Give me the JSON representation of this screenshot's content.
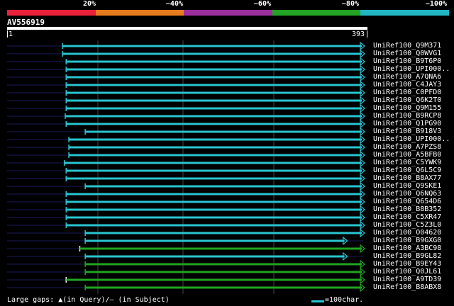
{
  "legend": {
    "labels": [
      "20%",
      "~40%",
      "~60%",
      "~80%",
      "~100%"
    ],
    "colors": [
      "#e8203a",
      "#e57c1e",
      "#9b2f9e",
      "#23a323",
      "#22b6c1"
    ]
  },
  "query": {
    "id": "AV556919",
    "start_label": "1",
    "end_label": "393",
    "length": 393
  },
  "colors": {
    "faint_line": "#1a1a5a",
    "grid": "#444444",
    "cyan": "#29c5cf",
    "green": "#1fa51f"
  },
  "hits": [
    {
      "name": "UniRef100_Q9M371",
      "start": 62,
      "end": 393,
      "color": "cyan",
      "gap_start": false
    },
    {
      "name": "UniRef100_Q0WVG1",
      "start": 62,
      "end": 393,
      "color": "cyan",
      "gap_start": false
    },
    {
      "name": "UniRef100_B9T6P0",
      "start": 66,
      "end": 393,
      "color": "cyan",
      "gap_start": false
    },
    {
      "name": "UniRef100_UPI000..",
      "start": 66,
      "end": 393,
      "color": "cyan",
      "gap_start": false
    },
    {
      "name": "UniRef100_A7QNA6",
      "start": 66,
      "end": 393,
      "color": "cyan",
      "gap_start": false
    },
    {
      "name": "UniRef100_C4JAY3",
      "start": 66,
      "end": 393,
      "color": "cyan",
      "gap_start": false
    },
    {
      "name": "UniRef100_C0PFD0",
      "start": 66,
      "end": 393,
      "color": "cyan",
      "gap_start": false
    },
    {
      "name": "UniRef100_Q6K2T0",
      "start": 66,
      "end": 393,
      "color": "cyan",
      "gap_start": false
    },
    {
      "name": "UniRef100_Q9M155",
      "start": 66,
      "end": 393,
      "color": "cyan",
      "gap_start": false
    },
    {
      "name": "UniRef100_B9RCP8",
      "start": 65,
      "end": 393,
      "color": "cyan",
      "gap_start": false
    },
    {
      "name": "UniRef100_Q1PG90",
      "start": 66,
      "end": 393,
      "color": "cyan",
      "gap_start": false
    },
    {
      "name": "UniRef100_B918V3",
      "start": 87,
      "end": 393,
      "color": "cyan",
      "gap_start": false
    },
    {
      "name": "UniRef100_UPI000..",
      "start": 69,
      "end": 393,
      "color": "cyan",
      "gap_start": false
    },
    {
      "name": "UniRef100_A7PZS8",
      "start": 69,
      "end": 393,
      "color": "cyan",
      "gap_start": false
    },
    {
      "name": "UniRef100_A5BFB0",
      "start": 69,
      "end": 393,
      "color": "cyan",
      "gap_start": false
    },
    {
      "name": "UniRef100_C5YWK9",
      "start": 64,
      "end": 393,
      "color": "cyan",
      "gap_start": false
    },
    {
      "name": "UniRef100_Q6L5C9",
      "start": 66,
      "end": 393,
      "color": "cyan",
      "gap_start": false
    },
    {
      "name": "UniRef100_B8AX77",
      "start": 66,
      "end": 393,
      "color": "cyan",
      "gap_start": false
    },
    {
      "name": "UniRef100_Q9SKE1",
      "start": 87,
      "end": 393,
      "color": "cyan",
      "gap_start": false
    },
    {
      "name": "UniRef100_Q6NQ63",
      "start": 66,
      "end": 393,
      "color": "cyan",
      "gap_start": false
    },
    {
      "name": "UniRef100_Q654D6",
      "start": 66,
      "end": 393,
      "color": "cyan",
      "gap_start": false
    },
    {
      "name": "UniRef100_B8B352",
      "start": 66,
      "end": 393,
      "color": "cyan",
      "gap_start": false
    },
    {
      "name": "UniRef100_C5XR47",
      "start": 66,
      "end": 393,
      "color": "cyan",
      "gap_start": false
    },
    {
      "name": "UniRef100_C5Z3L0",
      "start": 66,
      "end": 393,
      "color": "cyan",
      "gap_start": false
    },
    {
      "name": "UniRef100_O04620",
      "start": 87,
      "end": 393,
      "color": "cyan",
      "gap_start": false
    },
    {
      "name": "UniRef100_B9GXG0",
      "start": 87,
      "end": 374,
      "color": "cyan",
      "gap_start": false
    },
    {
      "name": "UniRef100_A3BC98",
      "start": 81,
      "end": 393,
      "color": "green",
      "gap_start": true
    },
    {
      "name": "UniRef100_B9GL82",
      "start": 87,
      "end": 374,
      "color": "cyan",
      "gap_start": false
    },
    {
      "name": "UniRef100_B9EY43",
      "start": 87,
      "end": 393,
      "color": "green",
      "gap_start": false
    },
    {
      "name": "UniRef100_Q0JL61",
      "start": 87,
      "end": 393,
      "color": "green",
      "gap_start": false
    },
    {
      "name": "UniRef100_A9TD39",
      "start": 66,
      "end": 393,
      "color": "green",
      "gap_start": true
    },
    {
      "name": "UniRef100_B8ABX8",
      "start": 87,
      "end": 393,
      "color": "green",
      "gap_start": false
    }
  ],
  "footer": {
    "gaps_text": "Large gaps: ▲(in Query)/– (in Subject)",
    "scale_text": "=100char."
  }
}
